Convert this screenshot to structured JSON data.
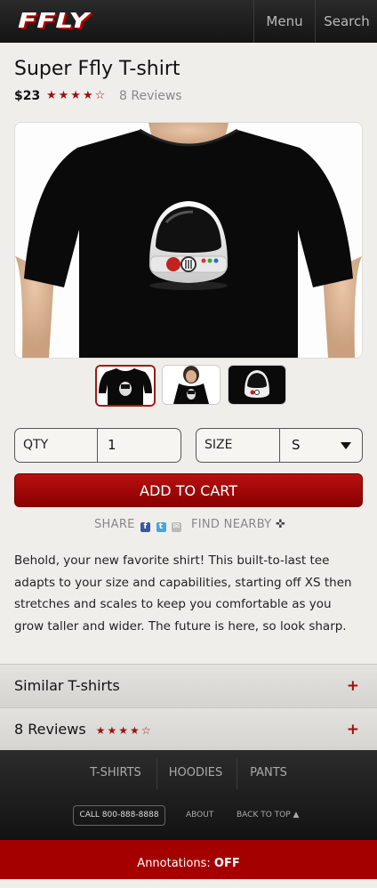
{
  "header": {
    "logo": "FFLY",
    "menu_label": "Menu",
    "search_label": "Search"
  },
  "product": {
    "title": "Super Ffly T-shirt",
    "price": "$23",
    "rating_stars": "★★★★☆",
    "review_count": "8 Reviews",
    "rating": 4
  },
  "options": {
    "qty_label": "QTY",
    "qty_value": "1",
    "size_label": "SIZE",
    "size_value": "S"
  },
  "cart_label": "ADD TO CART",
  "share": {
    "share_label": "SHARE",
    "find_label": "FIND NEARBY"
  },
  "description": "Behold, your new favorite shirt! This built-to-last tee adapts to your size and capabilities, starting off XS then stretches and scales to keep you comfortable as you grow taller and wider. The future is here, so look sharp.",
  "sections": {
    "similar": {
      "title": "Similar T-shirts",
      "toggle": "+"
    },
    "reviews": {
      "title": "8 Reviews",
      "stars": "★★★★☆",
      "toggle": "+"
    }
  },
  "footer": {
    "nav": [
      "T-SHIRTS",
      "HOODIES",
      "PANTS"
    ],
    "call": "CALL 800-888-8888",
    "about": "ABOUT",
    "back_to_top": "BACK TO TOP ▲"
  },
  "annotations": {
    "label": "Annotations:",
    "state": "OFF"
  },
  "colors": {
    "accent": "#a40000",
    "star": "#9b1111",
    "header": "#1a1a1a"
  }
}
